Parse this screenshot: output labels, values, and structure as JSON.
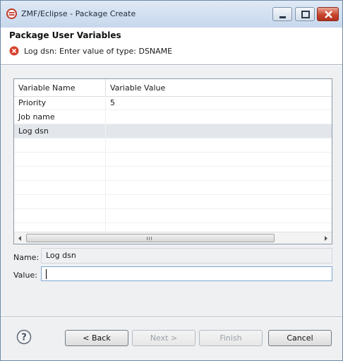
{
  "window": {
    "title": "ZMF/Eclipse - Package Create",
    "controls": [
      "minimize-icon",
      "maximize-icon",
      "close-icon"
    ]
  },
  "header": {
    "title": "Package User Variables",
    "error_message": "Log dsn: Enter value of type: DSNAME",
    "error_icon": "error-icon"
  },
  "table": {
    "columns": [
      "Variable Name",
      "Variable Value"
    ],
    "rows": [
      {
        "name": "Priority",
        "value": "5"
      },
      {
        "name": "Job name",
        "value": ""
      },
      {
        "name": "Log dsn",
        "value": ""
      }
    ],
    "selected_row": "Log dsn"
  },
  "form": {
    "name_label": "Name:",
    "name_value": "Log dsn",
    "value_label": "Value:",
    "value_value": ""
  },
  "buttons": {
    "back": "< Back",
    "next": "Next >",
    "finish": "Finish",
    "cancel": "Cancel"
  },
  "colors": {
    "error_red": "#d8412f",
    "selection": "#e3e6ea",
    "focus_border": "#7fa7cf"
  }
}
